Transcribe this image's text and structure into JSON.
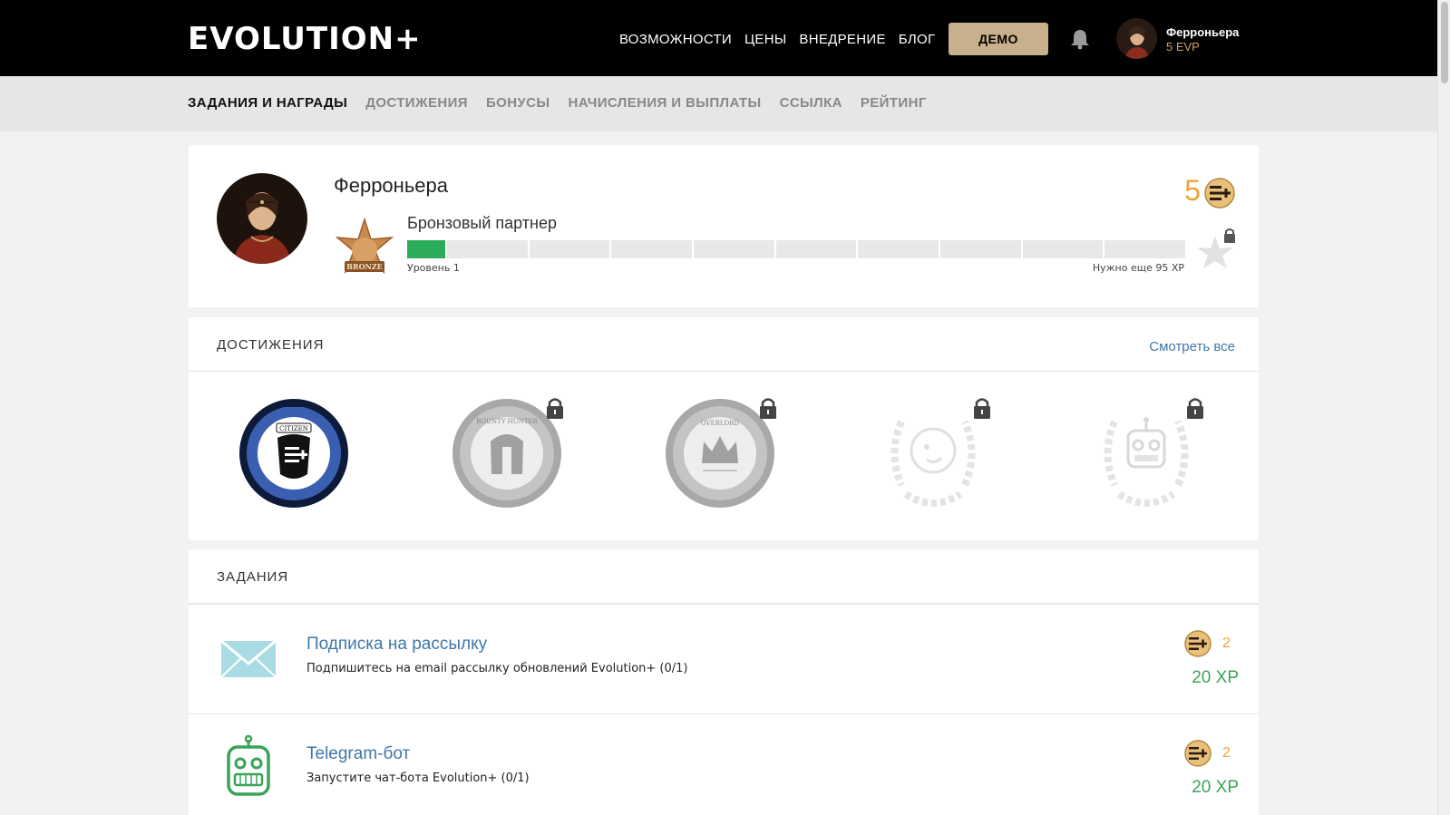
{
  "header": {
    "logo": "EVOLUTION+",
    "nav": [
      "ВОЗМОЖНОСТИ",
      "ЦЕНЫ",
      "ВНЕДРЕНИЕ",
      "БЛОГ"
    ],
    "demo_label": "ДЕМО",
    "user_name": "Ферроньера",
    "user_balance": "5 EVP"
  },
  "subnav": {
    "items": [
      "ЗАДАНИЯ И НАГРАДЫ",
      "ДОСТИЖЕНИЯ",
      "БОНУСЫ",
      "НАЧИСЛЕНИЯ И ВЫПЛАТЫ",
      "ССЫЛКА",
      "РЕЙТИНГ"
    ],
    "active_index": 0
  },
  "profile": {
    "name": "Ферроньера",
    "rank": "Бронзовый партнер",
    "rank_badge_text": "BRONZE",
    "level": "Уровень 1",
    "need": "Нужно еще 95 XP",
    "coins": "5",
    "progress_fraction": 0.05
  },
  "achievements": {
    "title": "ДОСТИЖЕНИЯ",
    "see_all": "Смотреть все",
    "items": [
      {
        "name": "CITIZEN",
        "locked": false
      },
      {
        "name": "BOUNTY HUNTER",
        "locked": true
      },
      {
        "name": "OVERLORD",
        "locked": true
      },
      {
        "name": "mailchimp",
        "locked": true
      },
      {
        "name": "robot",
        "locked": true
      }
    ]
  },
  "tasks": {
    "title": "ЗАДАНИЯ",
    "items": [
      {
        "title": "Подписка на рассылку",
        "desc": "Подпишитесь на email рассылку обновлений Evolution+ (0/1)",
        "reward": "2",
        "xp": "20 XP",
        "icon": "envelope-icon"
      },
      {
        "title": "Telegram-бот",
        "desc": "Запустите чат-бота Evolution+ (0/1)",
        "reward": "2",
        "xp": "20 XP",
        "icon": "robot-icon"
      }
    ]
  },
  "colors": {
    "accent": "#3f77a8",
    "coin": "#f0a236",
    "xp": "#3aa35a",
    "progress": "#2aac5a",
    "demo": "#c8b08d"
  }
}
